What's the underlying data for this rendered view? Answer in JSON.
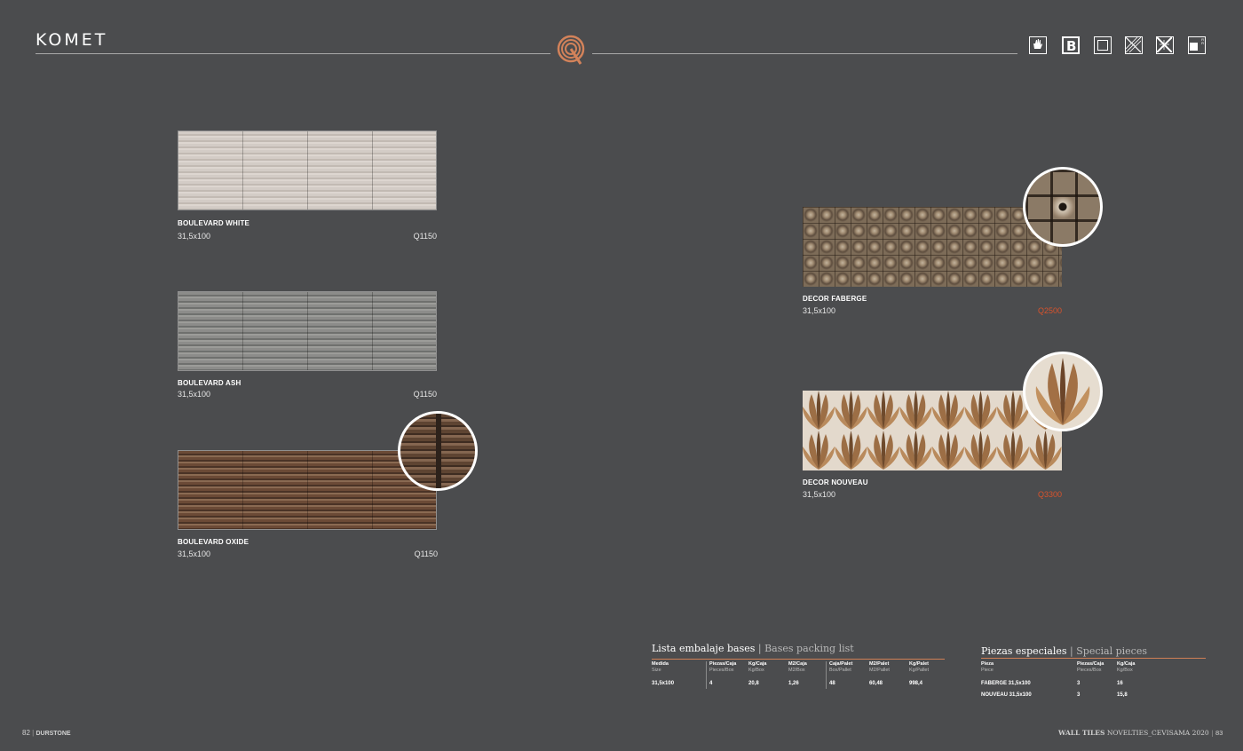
{
  "header": {
    "title": "KOMET"
  },
  "products_left": [
    {
      "name": "BOULEVARD WHITE",
      "size": "31,5x100",
      "code": "Q1150"
    },
    {
      "name": "BOULEVARD ASH",
      "size": "31,5x100",
      "code": "Q1150"
    },
    {
      "name": "BOULEVARD OXIDE",
      "size": "31,5x100",
      "code": "Q1150"
    }
  ],
  "products_right": [
    {
      "name": "DECOR FABERGE",
      "size": "31,5x100",
      "code": "Q2500"
    },
    {
      "name": "DECOR NOUVEAU",
      "size": "31,5x100",
      "code": "Q3300"
    }
  ],
  "packing": {
    "title": "Lista embalaje bases",
    "title_en": "Bases packing list",
    "headers": [
      {
        "es": "Medida",
        "en": "Size"
      },
      {
        "es": "Piezas/Caja",
        "en": "Pieces/Box"
      },
      {
        "es": "Kg/Caja",
        "en": "Kg/Box"
      },
      {
        "es": "M2/Caja",
        "en": "M2/Box"
      },
      {
        "es": "Caja/Palet",
        "en": "Box/Pallet"
      },
      {
        "es": "M2/Palet",
        "en": "M2/Pallet"
      },
      {
        "es": "Kg/Palet",
        "en": "Kg/Pallet"
      }
    ],
    "row": [
      "31,5x100",
      "4",
      "20,8",
      "1,26",
      "48",
      "60,48",
      "998,4"
    ]
  },
  "special": {
    "title": "Piezas especiales",
    "title_en": "Special pieces",
    "headers": [
      {
        "es": "Pieza",
        "en": "Piece"
      },
      {
        "es": "Piezas/Caja",
        "en": "Pieces/Box"
      },
      {
        "es": "Kg/Caja",
        "en": "Kg/Box"
      }
    ],
    "rows": [
      [
        "FABERGE 31,5x100",
        "3",
        "16"
      ],
      [
        "NOUVEAU 31,5x100",
        "3",
        "15,8"
      ]
    ]
  },
  "footer": {
    "left_page": "82",
    "brand": "DURSTONE",
    "right_text_bold": "WALL TILES",
    "right_text": "NOVELTIES_CEVISAMA 2020",
    "right_page": "83"
  },
  "colors": {
    "background": "#4b4c4e",
    "accent": "#d9532c",
    "rule": "#cf7f55"
  },
  "icons": [
    "hand-icon",
    "b-letter-icon",
    "square-icon",
    "diagonal-tile-icon",
    "cross-pattern-icon",
    "rectified-icon"
  ]
}
